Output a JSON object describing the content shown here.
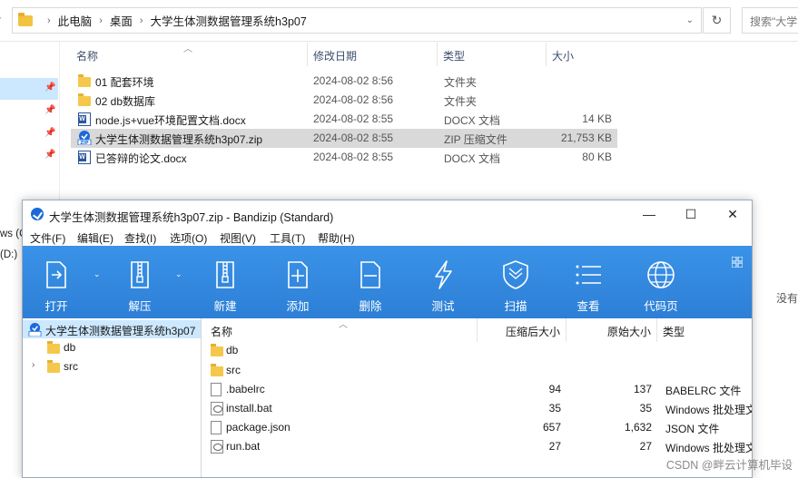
{
  "explorer": {
    "breadcrumb": [
      "此电脑",
      "桌面",
      "大学生体测数据管理系统h3p07"
    ],
    "search_placeholder": "搜索\"大学",
    "columns": {
      "name": "名称",
      "modified": "修改日期",
      "type": "类型",
      "size": "大小"
    },
    "files": [
      {
        "name": "01 配套环境",
        "modified": "2024-08-02 8:56",
        "type": "文件夹",
        "size": "",
        "icon": "folder-icon",
        "selected": false
      },
      {
        "name": "02 db数据库",
        "modified": "2024-08-02 8:56",
        "type": "文件夹",
        "size": "",
        "icon": "folder-icon",
        "selected": false
      },
      {
        "name": "node.js+vue环境配置文档.docx",
        "modified": "2024-08-02 8:55",
        "type": "DOCX 文档",
        "size": "14 KB",
        "icon": "word-doc-icon",
        "selected": false
      },
      {
        "name": "大学生体测数据管理系统h3p07.zip",
        "modified": "2024-08-02 8:55",
        "type": "ZIP 压缩文件",
        "size": "21,753 KB",
        "icon": "zip-icon",
        "selected": true
      },
      {
        "name": "已答辩的论文.docx",
        "modified": "2024-08-02 8:55",
        "type": "DOCX 文档",
        "size": "80 KB",
        "icon": "word-doc-icon",
        "selected": false
      }
    ],
    "nav_fragments": [
      "ws (C",
      "(D:)"
    ],
    "side_fragment": "没有"
  },
  "bandizip": {
    "title": "大学生体测数据管理系统h3p07.zip - Bandizip (Standard)",
    "menu": [
      "文件(F)",
      "编辑(E)",
      "查找(I)",
      "选项(O)",
      "视图(V)",
      "工具(T)",
      "帮助(H)"
    ],
    "toolbar": [
      {
        "label": "打开",
        "icon": "open-icon"
      },
      {
        "label": "解压",
        "icon": "extract-icon"
      },
      {
        "label": "新建",
        "icon": "new-archive-icon"
      },
      {
        "label": "添加",
        "icon": "add-file-icon"
      },
      {
        "label": "删除",
        "icon": "delete-file-icon"
      },
      {
        "label": "测试",
        "icon": "test-icon"
      },
      {
        "label": "扫描",
        "icon": "scan-shield-icon"
      },
      {
        "label": "查看",
        "icon": "view-list-icon"
      },
      {
        "label": "代码页",
        "icon": "codepage-globe-icon"
      }
    ],
    "tree": [
      {
        "label": "大学生体测数据管理系统h3p07",
        "selected": true,
        "expandable": false
      },
      {
        "label": "db",
        "selected": false,
        "expandable": false
      },
      {
        "label": "src",
        "selected": false,
        "expandable": true
      }
    ],
    "columns": {
      "name": "名称",
      "packed": "压缩后大小",
      "original": "原始大小",
      "type": "类型"
    },
    "files": [
      {
        "name": "db",
        "packed": "",
        "original": "",
        "type": "",
        "icon": "folder"
      },
      {
        "name": "src",
        "packed": "",
        "original": "",
        "type": "",
        "icon": "folder"
      },
      {
        "name": ".babelrc",
        "packed": "94",
        "original": "137",
        "type": "BABELRC 文件",
        "icon": "file"
      },
      {
        "name": "install.bat",
        "packed": "35",
        "original": "35",
        "type": "Windows 批处理文件",
        "icon": "bat"
      },
      {
        "name": "package.json",
        "packed": "657",
        "original": "1,632",
        "type": "JSON 文件",
        "icon": "file"
      },
      {
        "name": "run.bat",
        "packed": "27",
        "original": "27",
        "type": "Windows 批处理文件",
        "icon": "bat"
      }
    ]
  },
  "watermark": "CSDN @畔云计算机毕设",
  "colors": {
    "toolbar_blue": "#2d7fd6",
    "selection": "#cce8ff",
    "folder": "#f5c84c"
  }
}
